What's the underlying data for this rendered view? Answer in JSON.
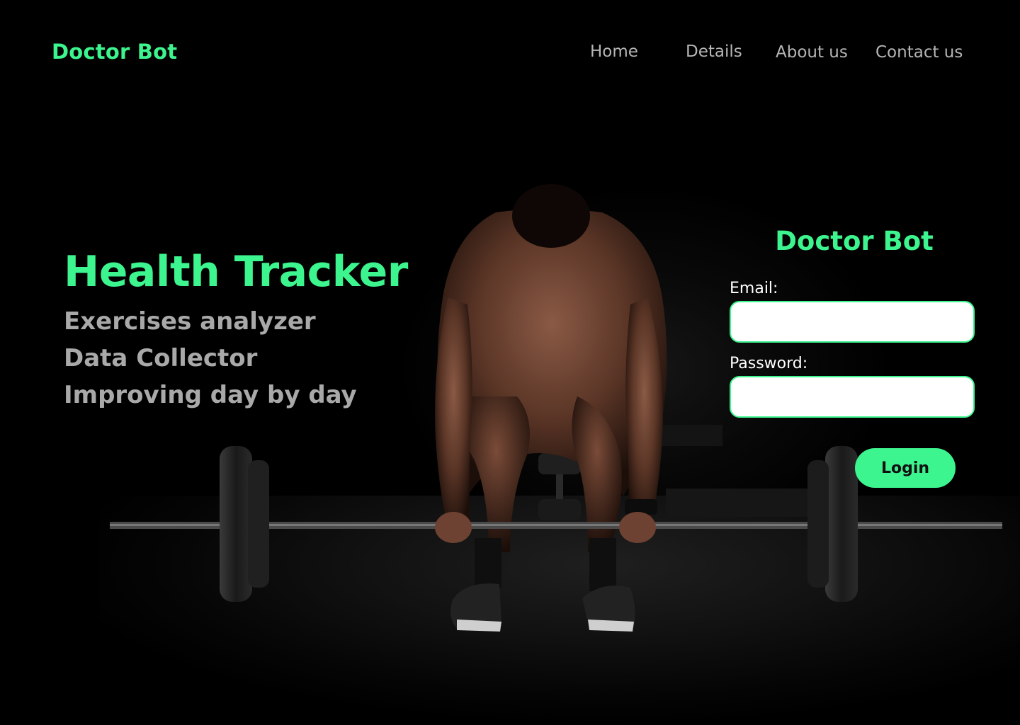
{
  "navbar": {
    "brand": "Doctor Bot",
    "links": [
      "Home",
      "Details",
      "About us",
      "Contact us"
    ]
  },
  "hero": {
    "title": "Health Tracker",
    "features": [
      "Exercises analyzer",
      "Data Collector",
      "Improving day by day"
    ]
  },
  "login": {
    "title": "Doctor Bot",
    "email_label": "Email:",
    "email_value": "",
    "password_label": "Password:",
    "password_value": "",
    "button_label": "Login"
  },
  "colors": {
    "accent": "#3df58e",
    "background": "#000000",
    "nav_text": "#b5b5b5",
    "feature_text": "#a9a9a9"
  }
}
